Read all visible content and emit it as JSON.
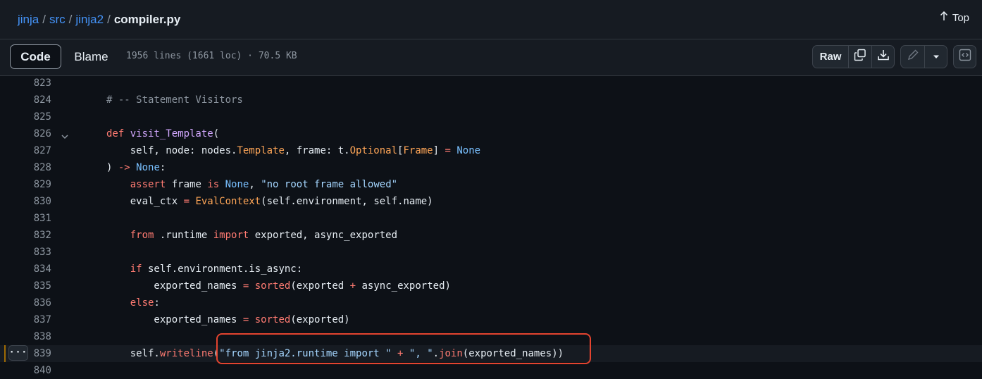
{
  "breadcrumb": {
    "items": [
      "jinja",
      "src",
      "jinja2"
    ],
    "separator": "/",
    "current": "compiler.py"
  },
  "top_link": {
    "label": "Top",
    "icon": "arrow-up-icon"
  },
  "toolbar": {
    "code_tab": "Code",
    "blame_tab": "Blame",
    "file_info": "1956 lines (1661 loc) · 70.5 KB",
    "raw_label": "Raw",
    "icons": [
      "copy-icon",
      "download-icon",
      "pencil-icon",
      "triangle-down-icon",
      "code-square-icon"
    ]
  },
  "colors": {
    "keyword": "#ff7b72",
    "function": "#d2a8ff",
    "class": "#ffa657",
    "constant": "#79c0ff",
    "string": "#a5d6ff",
    "comment": "#8b949e",
    "annotation_box": "#e3442f"
  },
  "code": {
    "lines": [
      {
        "num": "823",
        "tokens": []
      },
      {
        "num": "824",
        "tokens": [
          [
            "cm",
            "# -- Statement Visitors"
          ]
        ]
      },
      {
        "num": "825",
        "tokens": []
      },
      {
        "num": "826",
        "fold": true,
        "tokens": [
          [
            "kw",
            "def "
          ],
          [
            "fn",
            "visit_Template"
          ],
          [
            "",
            "("
          ]
        ]
      },
      {
        "num": "827",
        "tokens": [
          [
            "",
            "    self, node: nodes."
          ],
          [
            "cls",
            "Template"
          ],
          [
            "",
            ", frame: t."
          ],
          [
            "cls",
            "Optional"
          ],
          [
            "",
            "["
          ],
          [
            "cls",
            "Frame"
          ],
          [
            "",
            "] "
          ],
          [
            "kw",
            "="
          ],
          [
            "",
            " "
          ],
          [
            "cst",
            "None"
          ]
        ]
      },
      {
        "num": "828",
        "tokens": [
          [
            "",
            ") "
          ],
          [
            "kw",
            "->"
          ],
          [
            "",
            " "
          ],
          [
            "cst",
            "None"
          ],
          [
            "",
            ":"
          ]
        ]
      },
      {
        "num": "829",
        "tokens": [
          [
            "kw",
            "    assert"
          ],
          [
            "",
            " frame "
          ],
          [
            "kw",
            "is"
          ],
          [
            "",
            " "
          ],
          [
            "cst",
            "None"
          ],
          [
            "",
            ", "
          ],
          [
            "str",
            "\"no root frame allowed\""
          ]
        ]
      },
      {
        "num": "830",
        "tokens": [
          [
            "",
            "    eval_ctx "
          ],
          [
            "kw",
            "="
          ],
          [
            "",
            " "
          ],
          [
            "cls",
            "EvalContext"
          ],
          [
            "",
            "(self.environment, self.name)"
          ]
        ]
      },
      {
        "num": "831",
        "tokens": []
      },
      {
        "num": "832",
        "tokens": [
          [
            "kw",
            "    from"
          ],
          [
            "",
            " .runtime "
          ],
          [
            "kw",
            "import"
          ],
          [
            "",
            " exported, async_exported"
          ]
        ]
      },
      {
        "num": "833",
        "tokens": []
      },
      {
        "num": "834",
        "tokens": [
          [
            "kw",
            "    if"
          ],
          [
            "",
            " self.environment.is_async:"
          ]
        ]
      },
      {
        "num": "835",
        "tokens": [
          [
            "",
            "        exported_names "
          ],
          [
            "kw",
            "="
          ],
          [
            "",
            " "
          ],
          [
            "kw",
            "sorted"
          ],
          [
            "",
            "(exported "
          ],
          [
            "kw",
            "+"
          ],
          [
            "",
            " async_exported)"
          ]
        ]
      },
      {
        "num": "836",
        "tokens": [
          [
            "kw",
            "    else"
          ],
          [
            "",
            ":"
          ]
        ]
      },
      {
        "num": "837",
        "tokens": [
          [
            "",
            "        exported_names "
          ],
          [
            "kw",
            "="
          ],
          [
            "",
            " "
          ],
          [
            "kw",
            "sorted"
          ],
          [
            "",
            "(exported)"
          ]
        ]
      },
      {
        "num": "838",
        "tokens": []
      },
      {
        "num": "839",
        "highlight": true,
        "tokens": [
          [
            "",
            "    self."
          ],
          [
            "kw",
            "writeline"
          ],
          [
            "",
            "("
          ],
          [
            "str",
            "\"from jinja2.runtime import \""
          ],
          [
            "",
            " "
          ],
          [
            "kw",
            "+"
          ],
          [
            "",
            " "
          ],
          [
            "str",
            "\", \""
          ],
          [
            "",
            "."
          ],
          [
            "kw",
            "join"
          ],
          [
            "",
            "(exported_names))"
          ]
        ]
      },
      {
        "num": "840",
        "tokens": []
      }
    ]
  }
}
